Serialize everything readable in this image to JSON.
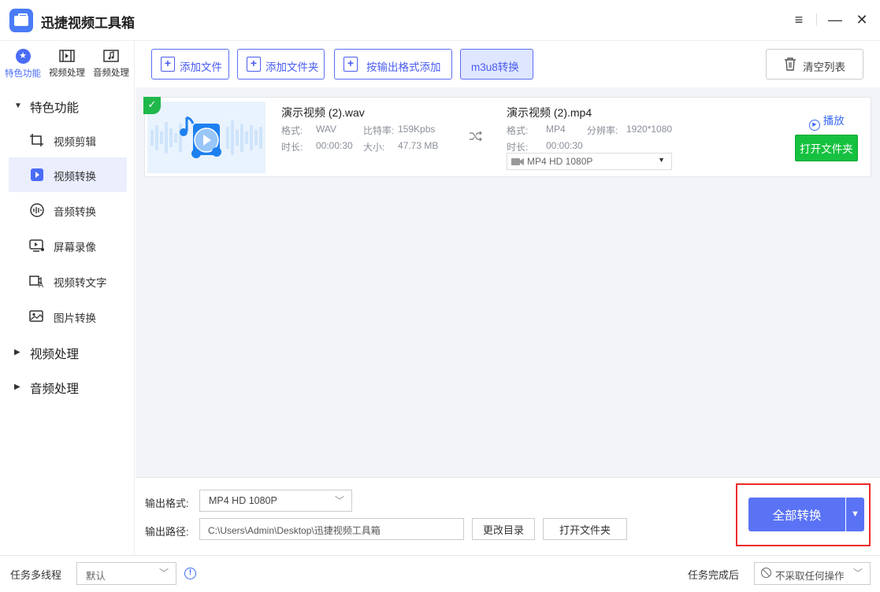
{
  "app": {
    "title": "迅捷视频工具箱"
  },
  "window": {
    "menu_icon": "hamburger-icon",
    "minimize_icon": "minimize-icon",
    "close_icon": "close-icon"
  },
  "topnav": [
    {
      "label": "特色功能",
      "icon": "star-icon",
      "active": true
    },
    {
      "label": "视频处理",
      "icon": "film-icon",
      "active": false
    },
    {
      "label": "音频处理",
      "icon": "music-icon",
      "active": false
    }
  ],
  "sidebar": {
    "group_featured": "特色功能",
    "items": [
      {
        "label": "视频剪辑",
        "icon": "crop-icon"
      },
      {
        "label": "视频转换",
        "icon": "video-convert-icon",
        "active": true
      },
      {
        "label": "音频转换",
        "icon": "audio-wave-icon"
      },
      {
        "label": "屏幕录像",
        "icon": "screen-record-icon"
      },
      {
        "label": "视频转文字",
        "icon": "video-to-text-icon"
      },
      {
        "label": "图片转换",
        "icon": "image-icon"
      }
    ],
    "group_video": "视频处理",
    "group_audio": "音频处理"
  },
  "toolbar": {
    "add_file": "添加文件",
    "add_folder": "添加文件夹",
    "add_by_format": "按输出格式添加",
    "m3u8": "m3u8转换",
    "clear_list": "清空列表"
  },
  "file": {
    "source_name": "演示视频 (2).wav",
    "format_label": "格式:",
    "format_value": "WAV",
    "bitrate_label": "比特率:",
    "bitrate_value": "159Kpbs",
    "duration_label": "时长:",
    "duration_value": "00:00:30",
    "size_label": "大小:",
    "size_value": "47.73 MB",
    "target_name": "演示视频 (2).mp4",
    "target_format_label": "格式:",
    "target_format_value": "MP4",
    "resolution_label": "分辨率:",
    "resolution_value": "1920*1080",
    "target_duration_label": "时长:",
    "target_duration_value": "00:00:30",
    "output_preset": "MP4  HD 1080P",
    "play": "播放",
    "open_folder": "打开文件夹"
  },
  "output": {
    "format_label": "输出格式:",
    "format_value": "MP4  HD 1080P",
    "path_label": "输出路径:",
    "path_value": "C:\\Users\\Admin\\Desktop\\迅捷视频工具箱",
    "change_dir": "更改目录",
    "open_folder": "打开文件夹",
    "convert_all": "全部转换"
  },
  "status": {
    "threads_label": "任务多线程",
    "threads_value": "默认",
    "after_label": "任务完成后",
    "after_value": "不采取任何操作"
  },
  "colors": {
    "accent": "#5a73f5",
    "success": "#16c140",
    "highlight_box": "#ee2a2a"
  }
}
